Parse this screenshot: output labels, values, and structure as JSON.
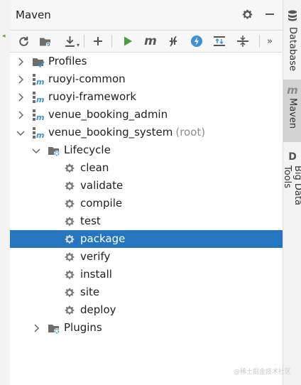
{
  "panel": {
    "title": "Maven"
  },
  "right_tabs": [
    {
      "label": "Database",
      "icon": "database-icon"
    },
    {
      "label": "Maven",
      "icon": "maven-m-icon"
    },
    {
      "label": "Big Data Tools",
      "icon": "big-data-d-icon"
    }
  ],
  "tree": {
    "profiles": "Profiles",
    "ruoyi_common": "ruoyi-common",
    "ruoyi_framework": "ruoyi-framework",
    "venue_booking_admin": "venue_booking_admin",
    "venue_booking_system": "venue_booking_system",
    "root_suffix": "(root)",
    "lifecycle": "Lifecycle",
    "goals": [
      "clean",
      "validate",
      "compile",
      "test",
      "package",
      "verify",
      "install",
      "site",
      "deploy"
    ],
    "plugins": "Plugins"
  },
  "selected_goal": "package",
  "colors": {
    "selection": "#2675bf",
    "run_green": "#4a9c3d",
    "accent_blue": "#3d8fd6"
  },
  "watermark": "@稀土掘金技术社区"
}
